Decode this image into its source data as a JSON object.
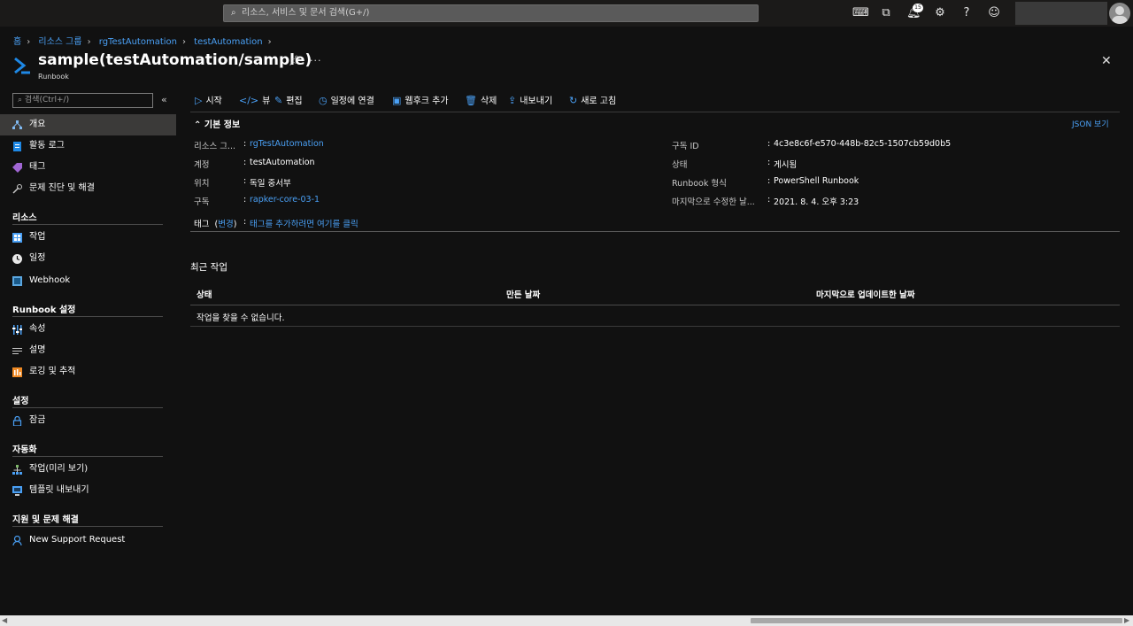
{
  "topbar": {
    "search_placeholder": "리소스, 서비스 및 문서 검색(G+/)",
    "notification_count": "15",
    "icons": [
      "cloud-shell-icon",
      "directory-filter-icon",
      "notification-icon",
      "settings-icon",
      "help-icon",
      "feedback-icon"
    ]
  },
  "breadcrumb": [
    "홈",
    "리소스 그룹",
    "rgTestAutomation",
    "testAutomation"
  ],
  "header": {
    "title": "sample(testAutomation/sample)",
    "subtitle": "Runbook"
  },
  "sidebar": {
    "search_placeholder": "검색(Ctrl+/)",
    "top_items": [
      {
        "label": "개요",
        "icon": "overview-icon",
        "active": true
      },
      {
        "label": "활동 로그",
        "icon": "activity-log-icon"
      },
      {
        "label": "태그",
        "icon": "tag-icon"
      },
      {
        "label": "문제 진단 및 해결",
        "icon": "wrench-icon"
      }
    ],
    "sections": [
      {
        "title": "리소스",
        "items": [
          {
            "label": "작업",
            "icon": "jobs-icon"
          },
          {
            "label": "일정",
            "icon": "clock-icon"
          },
          {
            "label": "Webhook",
            "icon": "webhook-icon"
          }
        ]
      },
      {
        "title": "Runbook 설정",
        "items": [
          {
            "label": "속성",
            "icon": "properties-icon"
          },
          {
            "label": "설명",
            "icon": "description-icon"
          },
          {
            "label": "로깅 및 추적",
            "icon": "logging-icon"
          }
        ]
      },
      {
        "title": "설정",
        "items": [
          {
            "label": "잠금",
            "icon": "lock-icon"
          }
        ]
      },
      {
        "title": "자동화",
        "items": [
          {
            "label": "작업(미리 보기)",
            "icon": "tasks-icon"
          },
          {
            "label": "템플릿 내보내기",
            "icon": "export-template-icon"
          }
        ]
      },
      {
        "title": "지원 및 문제 해결",
        "items": [
          {
            "label": "New Support Request",
            "icon": "support-icon"
          }
        ]
      }
    ]
  },
  "commands": [
    {
      "label": "시작",
      "icon": "play-icon"
    },
    {
      "label": "뷰",
      "icon": "code-icon"
    },
    {
      "label": "편집",
      "icon": "edit-icon"
    },
    {
      "label": "일정에 연결",
      "icon": "schedule-icon"
    },
    {
      "label": "웹후크 추가",
      "icon": "webhook-add-icon"
    },
    {
      "label": "삭제",
      "icon": "delete-icon"
    },
    {
      "label": "내보내기",
      "icon": "export-icon"
    },
    {
      "label": "새로 고침",
      "icon": "refresh-icon"
    }
  ],
  "essentials": {
    "heading": "기본 정보",
    "json_view": "JSON 보기",
    "left": [
      {
        "label": "리소스 그...",
        "value": "rgTestAutomation",
        "link": true
      },
      {
        "label": "계정",
        "value": "testAutomation",
        "link": false
      },
      {
        "label": "위치",
        "value": "독일 중서부",
        "link": false
      },
      {
        "label": "구독",
        "value": "rapker-core-03-1",
        "link": true
      }
    ],
    "right": [
      {
        "label": "구독 ID",
        "value": "4c3e8c6f-e570-448b-82c5-1507cb59d0b5"
      },
      {
        "label": "상태",
        "value": "게시됨"
      },
      {
        "label": "Runbook 형식",
        "value": "PowerShell Runbook"
      },
      {
        "label": "마지막으로 수정한 날...",
        "value": "2021. 8. 4. 오후 3:23"
      }
    ],
    "tags_label": "태그",
    "tags_change": "변경",
    "tags_value": "태그를 추가하려면 여기를 클릭"
  },
  "recent_jobs": {
    "title": "최근 작업",
    "columns": [
      "상태",
      "만든 날짜",
      "마지막으로 업데이트한 날짜"
    ],
    "empty_message": "작업을 찾을 수 없습니다."
  },
  "colors": {
    "background": "#111111",
    "link": "#4aa0f5",
    "active_nav": "#3b3a39"
  }
}
